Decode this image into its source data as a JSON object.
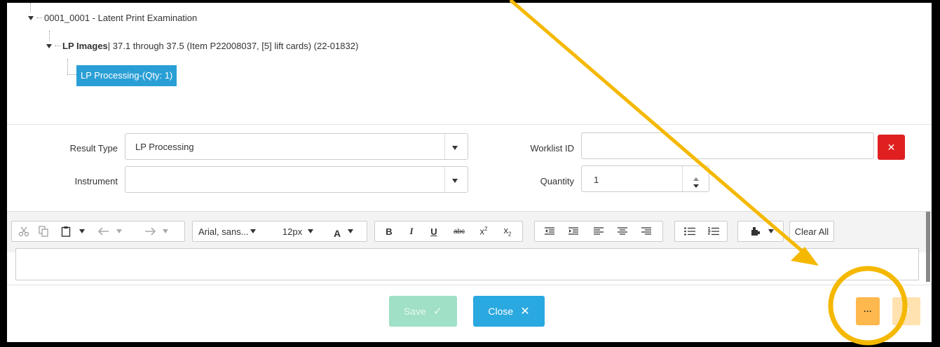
{
  "tree": {
    "root_label": "0001_0001 - Latent Print Examination",
    "child_bold": "LP Images",
    "child_rest": " | 37.1 through 37.5 (Item P22008037, [5] lift cards) (22-01832)",
    "selected_label": "LP Processing-(Qty: 1)"
  },
  "form": {
    "result_type_label": "Result Type",
    "result_type_value": "LP Processing",
    "instrument_label": "Instrument",
    "instrument_value": "",
    "worklist_label": "Worklist ID",
    "worklist_value": "",
    "quantity_label": "Quantity",
    "quantity_value": "1"
  },
  "toolbar": {
    "font_family": "Arial, sans...",
    "font_size": "12px",
    "font_color_glyph": "A",
    "bold": "B",
    "italic": "I",
    "underline": "U",
    "strike": "abc",
    "clear_all": "Clear All"
  },
  "footer": {
    "save_label": "Save",
    "close_label": "Close",
    "more_label": "···"
  },
  "colors": {
    "selected_bg": "#2a9fd6",
    "save_bg": "#9fe0c6",
    "close_bg": "#2aa8e0",
    "more_bg": "#ffb84d",
    "remove_bg": "#e02020",
    "annotation": "#f5b800"
  }
}
